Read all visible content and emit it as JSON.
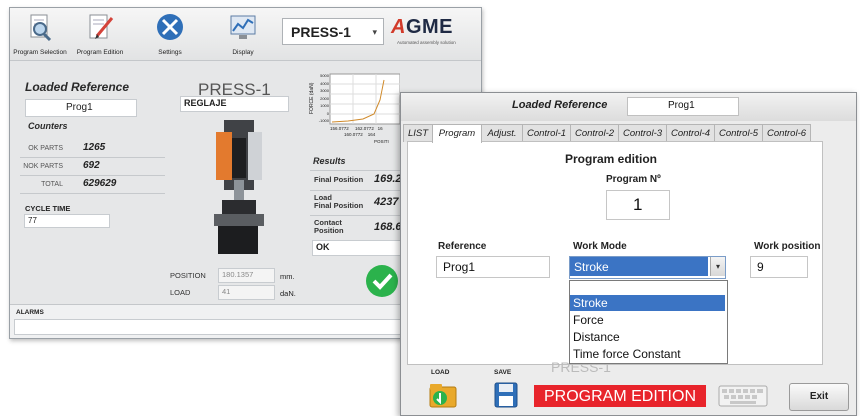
{
  "back_window": {
    "toolbar": {
      "buttons": [
        {
          "label": "Program Selection",
          "icon": "magnifier-document-icon"
        },
        {
          "label": "Program Edition",
          "icon": "pencil-document-icon"
        },
        {
          "label": "Settings",
          "icon": "wrench-screwdriver-icon"
        },
        {
          "label": "Display",
          "icon": "display-chart-icon"
        }
      ],
      "press_select": "PRESS-1",
      "logo": {
        "text_a": "A",
        "text_rest": "GME",
        "tagline": "Automated assembly solution"
      }
    },
    "loaded_reference": {
      "title": "Loaded Reference",
      "value": "Prog1"
    },
    "counters": {
      "title": "Counters",
      "ok_label": "OK PARTS",
      "ok_value": "1265",
      "nok_label": "NOK PARTS",
      "nok_value": "692",
      "total_label": "TOTAL",
      "total_value": "629629"
    },
    "cycle_time": {
      "label": "CYCLE TIME",
      "value": "77"
    },
    "press_title": "PRESS-1",
    "program_label": "REGLAJE",
    "chart": {
      "ylabel": "FORCE (daN)",
      "xlabel": "POSITI",
      "yticks": [
        "5000",
        "4000",
        "3000",
        "2000",
        "1000",
        "0",
        "-1000"
      ],
      "xticks_row1": [
        "156.0772",
        "162.0772",
        "16"
      ],
      "xticks_row2": [
        "160.0772",
        "164"
      ]
    },
    "results": {
      "title": "Results",
      "final_position_label": "Final Position",
      "final_position_value": "169.2",
      "load_final_position_label1": "Load",
      "load_final_position_label2": "Final Position",
      "load_final_position_value": "4237",
      "contact_position_label1": "Contact",
      "contact_position_label2": "Position",
      "contact_position_value": "168.6",
      "status": "OK"
    },
    "position": {
      "label": "POSITION",
      "value": "180.1357",
      "unit": "mm."
    },
    "load": {
      "label": "LOAD",
      "value": "41",
      "unit": "daN."
    },
    "alarms_label": "ALARMS"
  },
  "front_window": {
    "header": {
      "title": "Loaded Reference",
      "value": "Prog1"
    },
    "tabs": [
      "LIST",
      "Program",
      "Adjust.",
      "Control-1",
      "Control-2",
      "Control-3",
      "Control-4",
      "Control-5",
      "Control-6"
    ],
    "active_tab": "Program",
    "section_title": "Program edition",
    "program_number_label": "Program Nº",
    "program_number_value": "1",
    "reference": {
      "label": "Reference",
      "value": "Prog1"
    },
    "work_mode": {
      "label": "Work Mode",
      "value": "Stroke",
      "options": [
        "Stroke",
        "Force",
        "Distance",
        "Time force Constant"
      ],
      "selected_option": "Stroke"
    },
    "work_position": {
      "label": "Work position",
      "value": "9"
    },
    "footer": {
      "load_label": "LOAD",
      "save_label": "SAVE",
      "background_text": "PRESS-1",
      "mode_banner": "PROGRAM EDITION",
      "exit_label": "Exit"
    }
  },
  "colors": {
    "accent_blue": "#3b74c4",
    "banner_red": "#e8242b",
    "ok_green": "#2bb24c"
  }
}
